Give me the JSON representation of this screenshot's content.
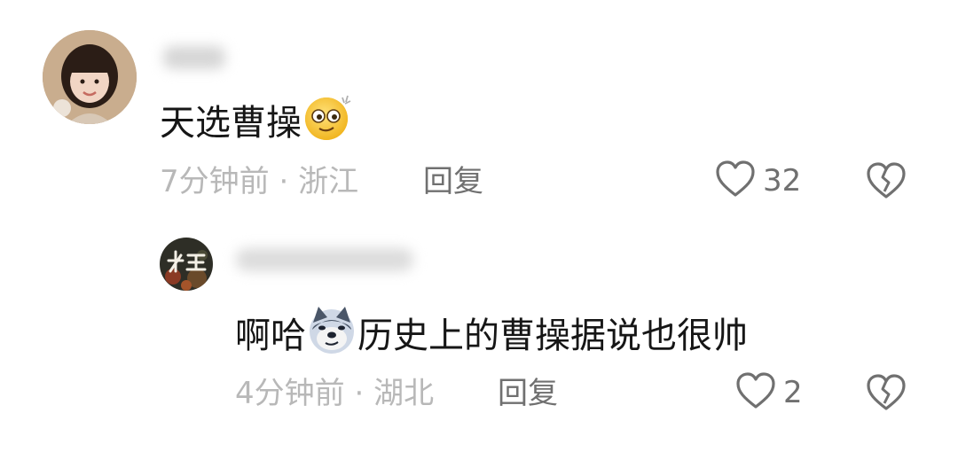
{
  "comments": [
    {
      "text_before": "天选曹操",
      "text_after": "",
      "emoji": "dizzy-face-emoji",
      "time": "7分钟前",
      "separator": "·",
      "location": "浙江",
      "reply_label": "回复",
      "likes": "32"
    },
    {
      "text_before": "啊哈",
      "text_after": "历史上的曹操据说也很帅",
      "emoji": "doge-emoji",
      "time": "4分钟前",
      "separator": "·",
      "location": "湖北",
      "reply_label": "回复",
      "likes": "2"
    }
  ],
  "icons": {
    "like": "heart-outline-icon",
    "dislike": "broken-heart-icon"
  },
  "colors": {
    "text": "#161616",
    "meta": "#b8b8b8",
    "action": "#707070"
  }
}
